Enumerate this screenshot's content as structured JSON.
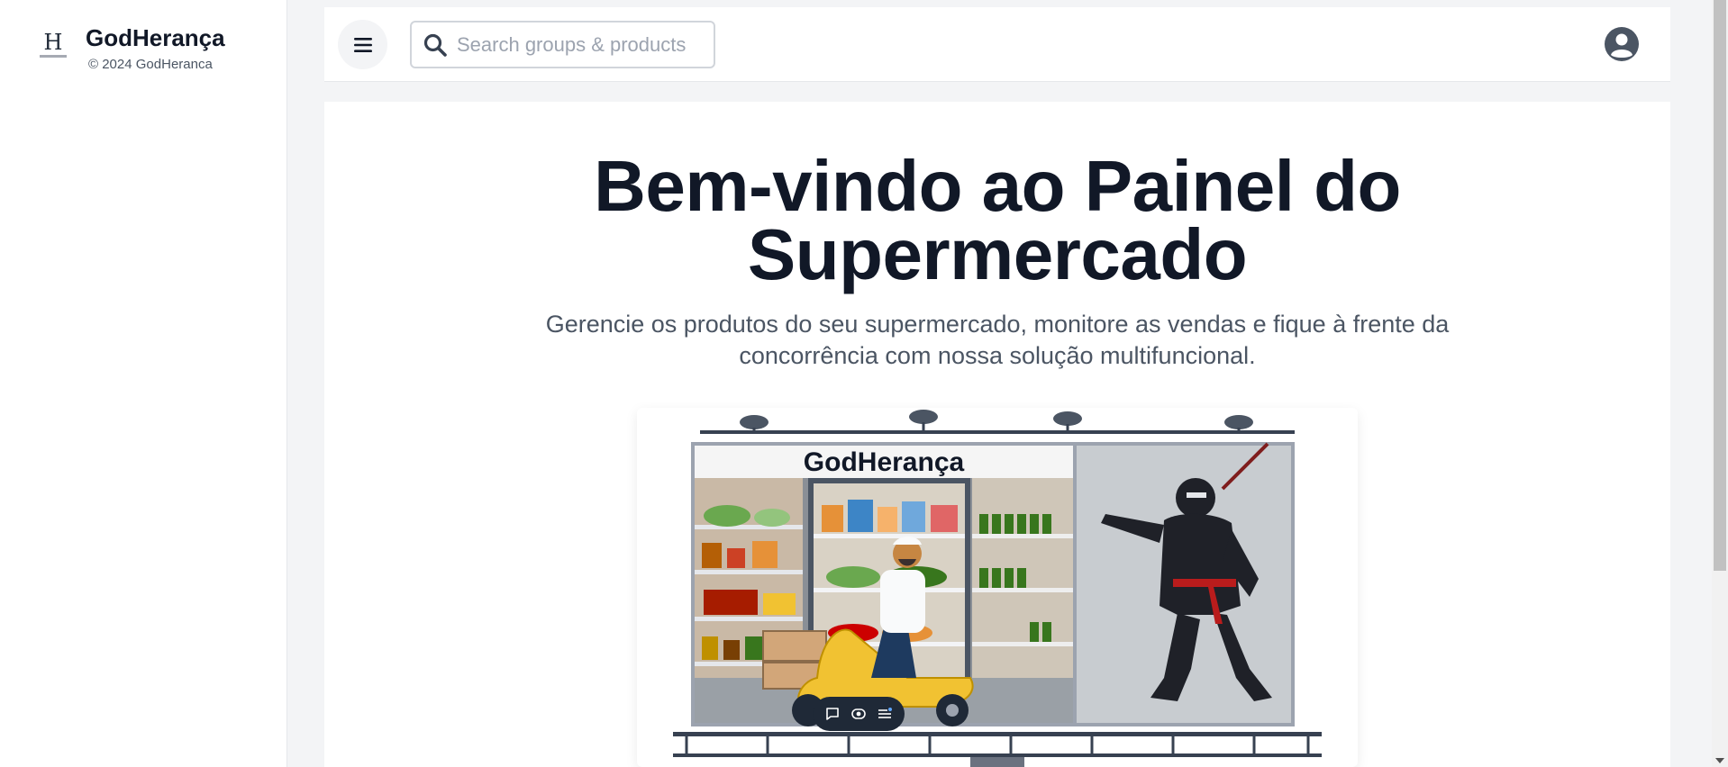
{
  "sidebar": {
    "brand_name": "GodHerança",
    "copyright": "© 2024 GodHeranca",
    "logo_icon": "godheranca-logo"
  },
  "topbar": {
    "menu_icon": "hamburger-menu-icon",
    "search": {
      "placeholder": "Search groups & products",
      "value": ""
    },
    "user_icon": "user-avatar-icon"
  },
  "main": {
    "title_line1": "Bem-vindo ao Painel do",
    "title_line2": "Supermercado",
    "subtitle": "Gerencie os produtos do seu supermercado, monitore as vendas e fique à frente da concorrência com nossa solução multifuncional.",
    "billboard": {
      "caption": "GodHerança"
    }
  },
  "colors": {
    "title": "#111827",
    "subtitle": "#4b5563",
    "background": "#f3f4f6",
    "card": "#ffffff"
  }
}
